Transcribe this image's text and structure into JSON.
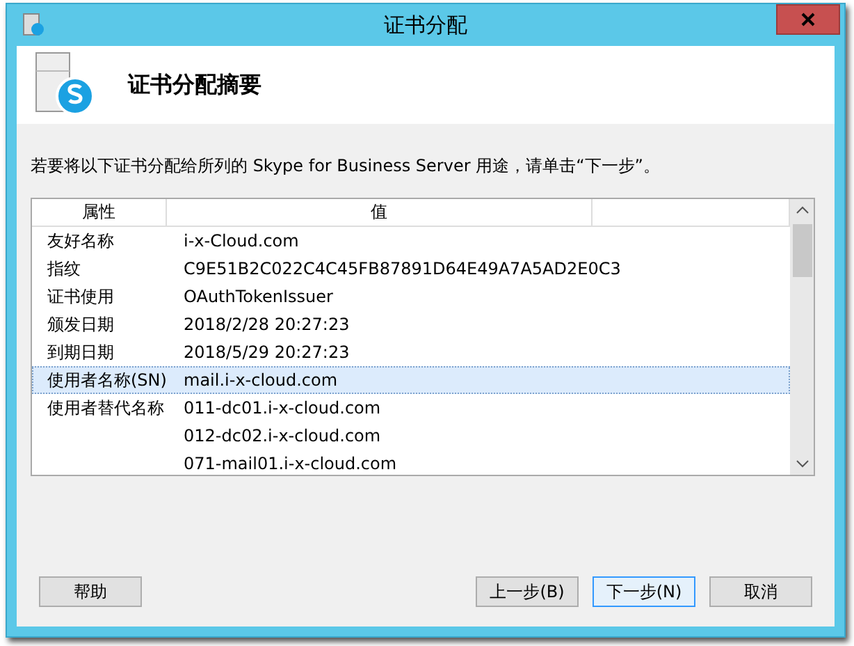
{
  "window": {
    "title": "证书分配"
  },
  "header": {
    "title": "证书分配摘要"
  },
  "instruction": "若要将以下证书分配给所列的 Skype for Business Server 用途，请单击“下一步”。",
  "table": {
    "columns": [
      "属性",
      "值"
    ],
    "rows": [
      {
        "property": "友好名称",
        "value": "i-x-Cloud.com",
        "selected": false
      },
      {
        "property": "指纹",
        "value": "C9E51B2C022C4C45FB87891D64E49A7A5AD2E0C3",
        "selected": false
      },
      {
        "property": "证书使用",
        "value": "OAuthTokenIssuer",
        "selected": false
      },
      {
        "property": "颁发日期",
        "value": "2018/2/28 20:27:23",
        "selected": false
      },
      {
        "property": "到期日期",
        "value": "2018/5/29 20:27:23",
        "selected": false
      },
      {
        "property": "使用者名称(SN)",
        "value": "mail.i-x-cloud.com",
        "selected": true
      },
      {
        "property": "使用者替代名称",
        "value": "011-dc01.i-x-cloud.com",
        "selected": false
      },
      {
        "value": "012-dc02.i-x-cloud.com",
        "selected": false
      },
      {
        "value": "071-mail01.i-x-cloud.com",
        "selected": false
      }
    ]
  },
  "help_button": "帮助",
  "buttons": [
    {
      "label": "上一步(B)",
      "default": false
    },
    {
      "label": "下一步(N)",
      "default": true
    },
    {
      "label": "取消",
      "default": false
    }
  ]
}
